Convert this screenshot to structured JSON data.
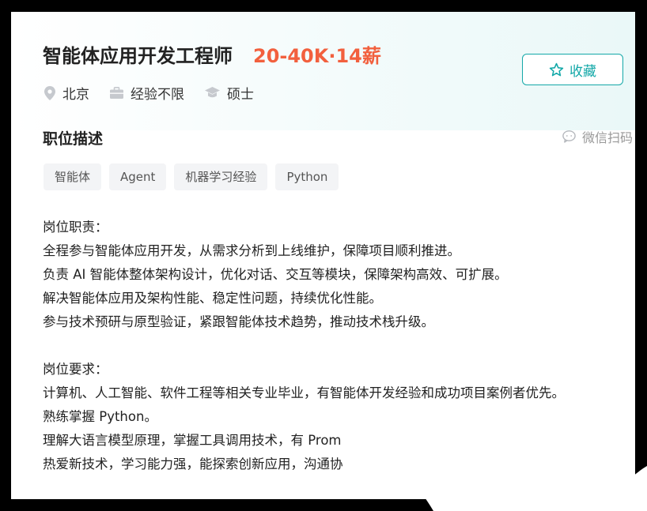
{
  "job": {
    "title": "智能体应用开发工程师",
    "salary": "20-40K·14薪",
    "location": "北京",
    "experience": "经验不限",
    "education": "硕士"
  },
  "actions": {
    "favorite_label": "收藏",
    "wechat_label": "微信扫码"
  },
  "description": {
    "section_title": "职位描述",
    "tags": [
      "智能体",
      "Agent",
      "机器学习经验",
      "Python"
    ],
    "duties_heading": "岗位职责：",
    "duties": [
      "全程参与智能体应用开发，从需求分析到上线维护，保障项目顺利推进。",
      "负责 AI 智能体整体架构设计，优化对话、交互等模块，保障架构高效、可扩展。",
      "解决智能体应用及架构性能、稳定性问题，持续优化性能。",
      "参与技术预研与原型验证，紧跟智能体技术趋势，推动技术栈升级。"
    ],
    "requirements_heading": "岗位要求：",
    "requirements": [
      "计算机、人工智能、软件工程等相关专业毕业，有智能体开发经验和成功项目案例者优先。",
      "熟练掌握 Python。",
      "理解大语言模型原理，掌握工具调用技术，有 Prom",
      "热爱新技术，学习能力强，能探索创新应用，沟通协"
    ]
  },
  "icons": {
    "location": "location-pin-icon",
    "experience": "briefcase-icon",
    "education": "graduation-cap-icon",
    "favorite": "star-icon",
    "wechat": "chat-bubble-icon"
  },
  "colors": {
    "accent": "#13a8a8",
    "salary": "#f2603e",
    "tag_bg": "#f3f4f6"
  }
}
